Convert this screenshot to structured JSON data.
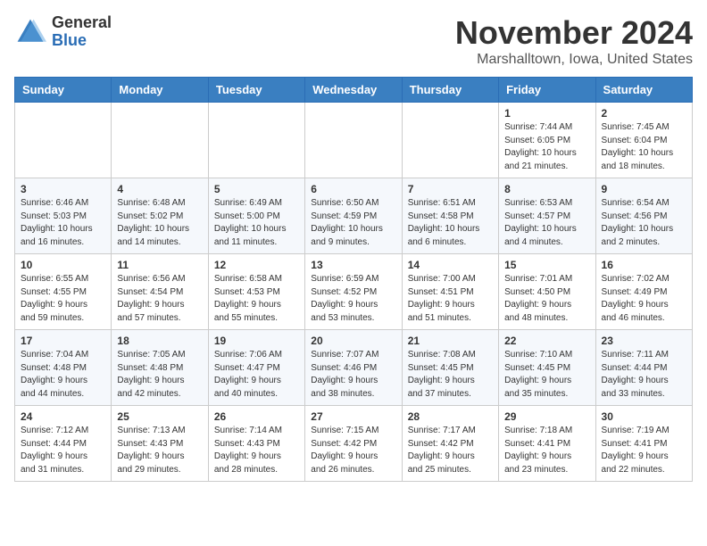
{
  "logo": {
    "general": "General",
    "blue": "Blue"
  },
  "title": "November 2024",
  "location": "Marshalltown, Iowa, United States",
  "weekdays": [
    "Sunday",
    "Monday",
    "Tuesday",
    "Wednesday",
    "Thursday",
    "Friday",
    "Saturday"
  ],
  "weeks": [
    [
      {
        "day": "",
        "info": ""
      },
      {
        "day": "",
        "info": ""
      },
      {
        "day": "",
        "info": ""
      },
      {
        "day": "",
        "info": ""
      },
      {
        "day": "",
        "info": ""
      },
      {
        "day": "1",
        "info": "Sunrise: 7:44 AM\nSunset: 6:05 PM\nDaylight: 10 hours\nand 21 minutes."
      },
      {
        "day": "2",
        "info": "Sunrise: 7:45 AM\nSunset: 6:04 PM\nDaylight: 10 hours\nand 18 minutes."
      }
    ],
    [
      {
        "day": "3",
        "info": "Sunrise: 6:46 AM\nSunset: 5:03 PM\nDaylight: 10 hours\nand 16 minutes."
      },
      {
        "day": "4",
        "info": "Sunrise: 6:48 AM\nSunset: 5:02 PM\nDaylight: 10 hours\nand 14 minutes."
      },
      {
        "day": "5",
        "info": "Sunrise: 6:49 AM\nSunset: 5:00 PM\nDaylight: 10 hours\nand 11 minutes."
      },
      {
        "day": "6",
        "info": "Sunrise: 6:50 AM\nSunset: 4:59 PM\nDaylight: 10 hours\nand 9 minutes."
      },
      {
        "day": "7",
        "info": "Sunrise: 6:51 AM\nSunset: 4:58 PM\nDaylight: 10 hours\nand 6 minutes."
      },
      {
        "day": "8",
        "info": "Sunrise: 6:53 AM\nSunset: 4:57 PM\nDaylight: 10 hours\nand 4 minutes."
      },
      {
        "day": "9",
        "info": "Sunrise: 6:54 AM\nSunset: 4:56 PM\nDaylight: 10 hours\nand 2 minutes."
      }
    ],
    [
      {
        "day": "10",
        "info": "Sunrise: 6:55 AM\nSunset: 4:55 PM\nDaylight: 9 hours\nand 59 minutes."
      },
      {
        "day": "11",
        "info": "Sunrise: 6:56 AM\nSunset: 4:54 PM\nDaylight: 9 hours\nand 57 minutes."
      },
      {
        "day": "12",
        "info": "Sunrise: 6:58 AM\nSunset: 4:53 PM\nDaylight: 9 hours\nand 55 minutes."
      },
      {
        "day": "13",
        "info": "Sunrise: 6:59 AM\nSunset: 4:52 PM\nDaylight: 9 hours\nand 53 minutes."
      },
      {
        "day": "14",
        "info": "Sunrise: 7:00 AM\nSunset: 4:51 PM\nDaylight: 9 hours\nand 51 minutes."
      },
      {
        "day": "15",
        "info": "Sunrise: 7:01 AM\nSunset: 4:50 PM\nDaylight: 9 hours\nand 48 minutes."
      },
      {
        "day": "16",
        "info": "Sunrise: 7:02 AM\nSunset: 4:49 PM\nDaylight: 9 hours\nand 46 minutes."
      }
    ],
    [
      {
        "day": "17",
        "info": "Sunrise: 7:04 AM\nSunset: 4:48 PM\nDaylight: 9 hours\nand 44 minutes."
      },
      {
        "day": "18",
        "info": "Sunrise: 7:05 AM\nSunset: 4:48 PM\nDaylight: 9 hours\nand 42 minutes."
      },
      {
        "day": "19",
        "info": "Sunrise: 7:06 AM\nSunset: 4:47 PM\nDaylight: 9 hours\nand 40 minutes."
      },
      {
        "day": "20",
        "info": "Sunrise: 7:07 AM\nSunset: 4:46 PM\nDaylight: 9 hours\nand 38 minutes."
      },
      {
        "day": "21",
        "info": "Sunrise: 7:08 AM\nSunset: 4:45 PM\nDaylight: 9 hours\nand 37 minutes."
      },
      {
        "day": "22",
        "info": "Sunrise: 7:10 AM\nSunset: 4:45 PM\nDaylight: 9 hours\nand 35 minutes."
      },
      {
        "day": "23",
        "info": "Sunrise: 7:11 AM\nSunset: 4:44 PM\nDaylight: 9 hours\nand 33 minutes."
      }
    ],
    [
      {
        "day": "24",
        "info": "Sunrise: 7:12 AM\nSunset: 4:44 PM\nDaylight: 9 hours\nand 31 minutes."
      },
      {
        "day": "25",
        "info": "Sunrise: 7:13 AM\nSunset: 4:43 PM\nDaylight: 9 hours\nand 29 minutes."
      },
      {
        "day": "26",
        "info": "Sunrise: 7:14 AM\nSunset: 4:43 PM\nDaylight: 9 hours\nand 28 minutes."
      },
      {
        "day": "27",
        "info": "Sunrise: 7:15 AM\nSunset: 4:42 PM\nDaylight: 9 hours\nand 26 minutes."
      },
      {
        "day": "28",
        "info": "Sunrise: 7:17 AM\nSunset: 4:42 PM\nDaylight: 9 hours\nand 25 minutes."
      },
      {
        "day": "29",
        "info": "Sunrise: 7:18 AM\nSunset: 4:41 PM\nDaylight: 9 hours\nand 23 minutes."
      },
      {
        "day": "30",
        "info": "Sunrise: 7:19 AM\nSunset: 4:41 PM\nDaylight: 9 hours\nand 22 minutes."
      }
    ]
  ]
}
